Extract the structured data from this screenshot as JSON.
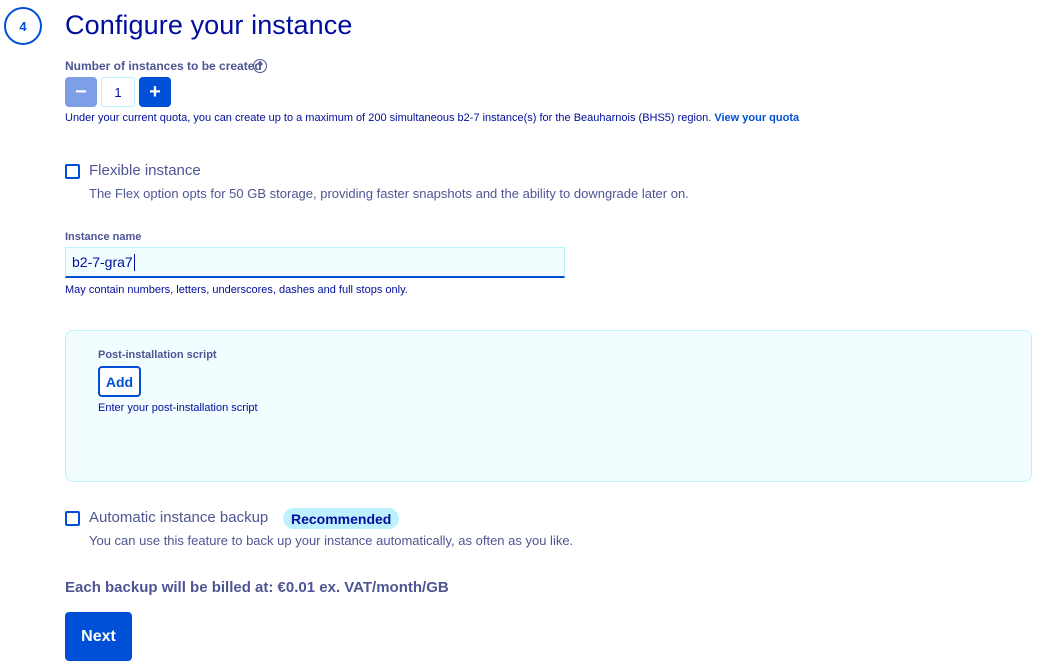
{
  "step": {
    "number": "4",
    "title": "Configure your instance"
  },
  "instances": {
    "label": "Number of instances to be created",
    "help_icon": "?",
    "decrement_label": "−",
    "increment_label": "+",
    "value": "1",
    "quota_text": "Under your current quota, you can create up to a maximum of 200 simultaneous b2-7 instance(s) for the Beauharnois (BHS5) region.",
    "quota_link": "View your quota"
  },
  "flexible": {
    "label": "Flexible instance",
    "description": "The Flex option opts for 50 GB storage, providing faster snapshots and the ability to downgrade later on.",
    "checked": false
  },
  "instance_name": {
    "label": "Instance name",
    "value": "b2-7-gra7",
    "hint": "May contain numbers, letters, underscores, dashes and full stops only."
  },
  "post_install": {
    "label": "Post-installation script",
    "add_label": "Add",
    "hint": "Enter your post-installation script"
  },
  "backup": {
    "label": "Automatic instance backup",
    "badge": "Recommended",
    "description": "You can use this feature to back up your instance automatically, as often as you like.",
    "checked": false
  },
  "billing_text": "Each backup will be billed at: €0.01 ex. VAT/month/GB",
  "next_label": "Next",
  "colors": {
    "primary": "#0050d7",
    "title": "#000e9c",
    "text": "#4d5693",
    "light_bg": "#f2fdff",
    "badge_bg": "#bef1ff"
  }
}
